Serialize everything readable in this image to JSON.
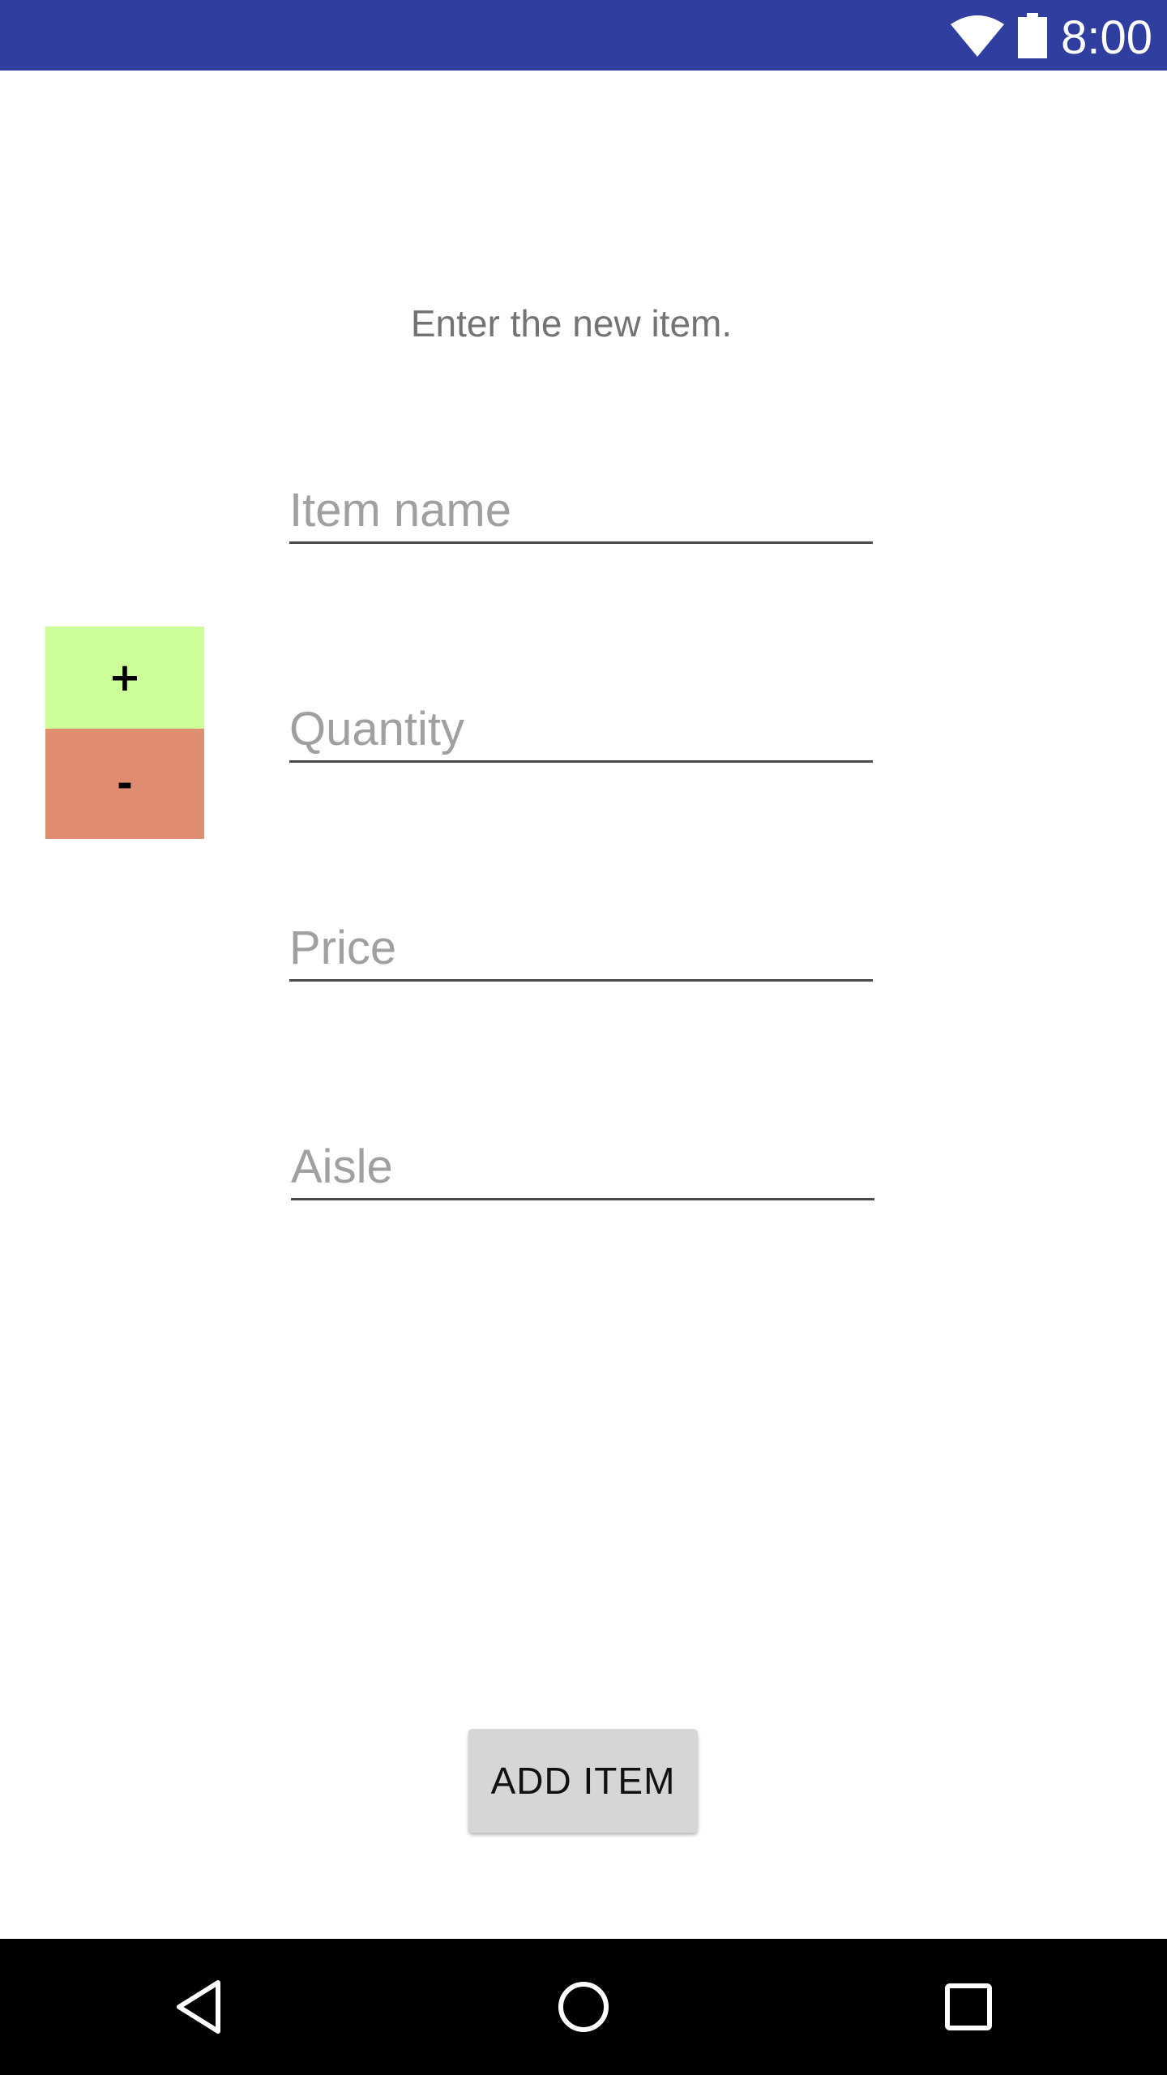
{
  "status_bar": {
    "time": "8:00",
    "background": "#303f9f",
    "icons": [
      "wifi-icon",
      "battery-icon"
    ]
  },
  "form": {
    "instruction": "Enter the new item.",
    "item_name_placeholder": "Item name",
    "quantity_placeholder": "Quantity",
    "price_placeholder": "Price",
    "aisle_placeholder": "Aisle"
  },
  "stepper": {
    "plus_label": "+",
    "minus_label": "-",
    "plus_color": "#ccff99",
    "minus_color": "#e08c70"
  },
  "actions": {
    "add_item_label": "ADD ITEM"
  },
  "nav_bar": {
    "icons": [
      "back-icon",
      "home-icon",
      "recent-apps-icon"
    ]
  }
}
